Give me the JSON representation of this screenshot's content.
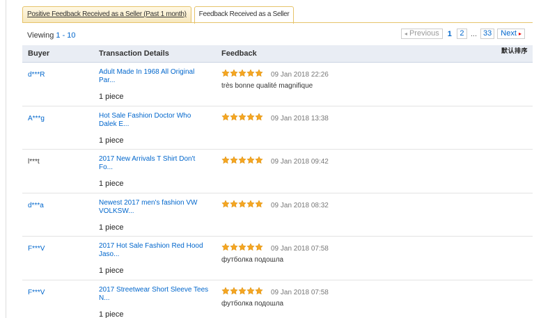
{
  "tabs": [
    {
      "label": "Positive Feedback Received as a Seller (Past 1 month)",
      "active": false
    },
    {
      "label": "Feedback Received as a Seller",
      "active": true
    }
  ],
  "viewing": {
    "prefix": "Viewing ",
    "range": "1 - 10"
  },
  "pagination": {
    "prev_label": "Previous",
    "current": "1",
    "page2": "2",
    "ellipsis": "...",
    "last": "33",
    "next_label": "Next"
  },
  "sort_label": "默认排序",
  "columns": {
    "buyer": "Buyer",
    "details": "Transaction Details",
    "feedback": "Feedback"
  },
  "colors": {
    "link": "#0066cc",
    "star": "#f5a623",
    "header_bg": "#e9edf4",
    "tab_border": "#e6c36a"
  },
  "rows": [
    {
      "buyer": "d***R",
      "buyer_link": true,
      "title": "Adult Made In 1968 All Original Par...",
      "qty": "1 piece",
      "rating": 5,
      "date": "09 Jan 2018 22:26",
      "comment": "très bonne qualité magnifique"
    },
    {
      "buyer": "A***g",
      "buyer_link": true,
      "title": "Hot Sale Fashion Doctor Who Dalek E...",
      "qty": "1 piece",
      "rating": 5,
      "date": "09 Jan 2018 13:38",
      "comment": ""
    },
    {
      "buyer": "l***t",
      "buyer_link": false,
      "title": "2017 New Arrivals T Shirt Don't Fo...",
      "qty": "1 piece",
      "rating": 5,
      "date": "09 Jan 2018 09:42",
      "comment": ""
    },
    {
      "buyer": "d***a",
      "buyer_link": true,
      "title": "Newest 2017 men's fashion VW VOLKSW...",
      "qty": "1 piece",
      "rating": 5,
      "date": "09 Jan 2018 08:32",
      "comment": ""
    },
    {
      "buyer": "F***V",
      "buyer_link": true,
      "title": "2017 Hot Sale Fashion Red Hood Jaso...",
      "qty": "1 piece",
      "rating": 5,
      "date": "09 Jan 2018 07:58",
      "comment": "футболка подошла"
    },
    {
      "buyer": "F***V",
      "buyer_link": true,
      "title": "2017 Streetwear Short Sleeve Tees N...",
      "qty": "1 piece",
      "rating": 5,
      "date": "09 Jan 2018 07:58",
      "comment": "футболка подошла"
    }
  ]
}
